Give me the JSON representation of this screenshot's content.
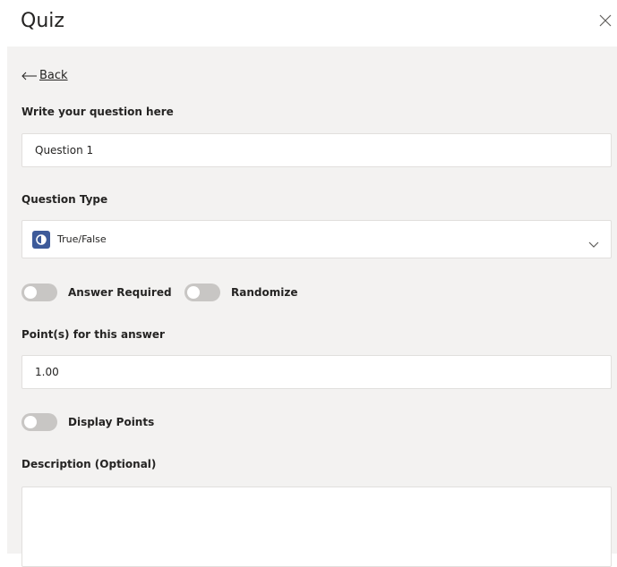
{
  "header": {
    "title": "Quiz",
    "close_icon": "close-icon"
  },
  "back": {
    "label": "Back",
    "icon": "arrow-left-icon"
  },
  "question": {
    "label": "Write your question here",
    "value": "Question 1"
  },
  "question_type": {
    "label": "Question Type",
    "selected": "True/False",
    "icon": "true-false-icon",
    "icon_color": "#3d5a99",
    "chevron": "chevron-down-icon"
  },
  "toggles": {
    "answer_required": "Answer Required",
    "randomize": "Randomize",
    "display_points": "Display Points"
  },
  "points": {
    "label": "Point(s) for this answer",
    "value": "1.00"
  },
  "description": {
    "label": "Description (Optional)",
    "value": ""
  },
  "colors": {
    "panel_bg": "#f3f2f1",
    "toggle_off": "#c8c6c4",
    "text": "#252423"
  }
}
